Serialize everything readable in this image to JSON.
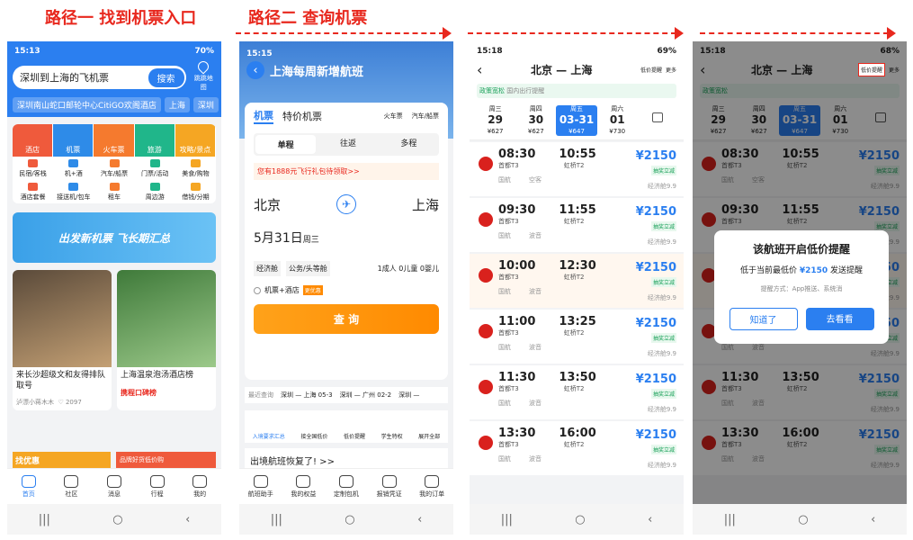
{
  "titles": {
    "path1": "路径一 找到机票入口",
    "path2": "路径二 查询机票"
  },
  "colors": {
    "accent": "#e8281e",
    "blue": "#2b7ff0",
    "orange": "#ff8a00"
  },
  "phone1": {
    "status_time": "15:13",
    "status_right": "70%",
    "search_text": "深圳到上海的飞机票",
    "search_btn": "搜索",
    "map_label": "跳跳地图",
    "chips": [
      "深圳南山蛇口邮轮中心CitiGO欢阁酒店",
      "上海",
      "深圳"
    ],
    "big_tiles": [
      "酒店",
      "机票",
      "火车票",
      "旅游",
      "攻略/景点"
    ],
    "big_colors": [
      "#ef5a3c",
      "#2e8be8",
      "#f57a2e",
      "#20b68a",
      "#f5a623"
    ],
    "small_row1": [
      "民宿/客栈",
      "机+酒",
      "汽车/船票",
      "门票/活动",
      "美食/购物"
    ],
    "small_row2": [
      "酒店套餐",
      "接送机/包车",
      "租车",
      "周边游",
      "借钱/分期"
    ],
    "banner": "出发新机票 飞长期汇总",
    "card1_title": "来长沙超级文和友得排队取号",
    "card1_user": "泸漂小蒋木木",
    "card1_views": "2097",
    "card2_title": "上海温泉泡汤酒店榜",
    "card2_tag": "携程口碑榜",
    "bottom_left": "找优惠",
    "bottom_right": "品牌好货低价购",
    "tabs": [
      "首页",
      "社区",
      "消息",
      "行程",
      "我的"
    ]
  },
  "phone2": {
    "status_time": "15:15",
    "hero_title": "上海每周新增航班",
    "tab_flight": "机票",
    "tab_special": "特价机票",
    "tab_train": "火车票",
    "tab_bus": "汽车/船票",
    "seg": [
      "单程",
      "往返",
      "多程"
    ],
    "promo": "您有1888元飞行礼包待领取>>",
    "from": "北京",
    "to": "上海",
    "date": "5月31日",
    "weekday": "周三",
    "cabin": "经济舱",
    "cabin2": "公务/头等舱",
    "pax": "1成人 0儿童 0婴儿",
    "hotel": "机票+酒店",
    "hotel_tag": "更优惠",
    "search_btn": "查 询",
    "recent_label": "最近查询",
    "recent": [
      "深圳 — 上海 05-3",
      "深圳 — 广州 02-2",
      "深圳 —"
    ],
    "quick": [
      "入境要求汇总",
      "接全国低价",
      "低价提醒",
      "学生特权",
      "展开全部"
    ],
    "notice": "出境航班恢复了! >>",
    "tabs": [
      "航班助手",
      "我的权益",
      "定制包机",
      "报销凭证",
      "我的订单"
    ]
  },
  "phone3": {
    "status_time": "15:18",
    "status_right": "69%",
    "route": "北京 — 上海",
    "alert_label": "低价提醒",
    "more_label": "更多",
    "notice": "政策宽松",
    "notice2": "国内出行提醒",
    "dates": [
      {
        "w": "周三",
        "d": "29",
        "p": "¥627"
      },
      {
        "w": "周四",
        "d": "30",
        "p": "¥627"
      },
      {
        "w": "周五",
        "d": "03-31",
        "p": "¥647"
      },
      {
        "w": "周六",
        "d": "01",
        "p": "¥730"
      }
    ],
    "flights": [
      {
        "dep": "08:30",
        "arr": "10:55",
        "da": "首都T3",
        "aa": "虹桥T2",
        "air": "国航",
        "plane": "空客",
        "price": "¥2150"
      },
      {
        "dep": "09:30",
        "arr": "11:55",
        "da": "首都T3",
        "aa": "虹桥T2",
        "air": "国航",
        "plane": "波音",
        "price": "¥2150"
      },
      {
        "dep": "10:00",
        "arr": "12:30",
        "da": "首都T3",
        "aa": "虹桥T2",
        "air": "国航",
        "plane": "波音",
        "price": "¥2150"
      },
      {
        "dep": "11:00",
        "arr": "13:25",
        "da": "首都T3",
        "aa": "虹桥T2",
        "air": "国航",
        "plane": "波音",
        "price": "¥2150"
      },
      {
        "dep": "11:30",
        "arr": "13:50",
        "da": "首都T3",
        "aa": "虹桥T2",
        "air": "国航",
        "plane": "波音",
        "price": "¥2150"
      },
      {
        "dep": "13:30",
        "arr": "16:00",
        "da": "首都T3",
        "aa": "虹桥T2",
        "air": "国航",
        "plane": "波音",
        "price": "¥2150"
      }
    ],
    "tag": "抽奖立减",
    "cabin": "经济舱9.9"
  },
  "phone4": {
    "status_time": "15:18",
    "status_right": "68%",
    "dlg_title": "该航班开启低价提醒",
    "dlg_sub_pre": "低于当前最低价",
    "dlg_sub_price": "¥2150",
    "dlg_sub_post": "发送提醒",
    "dlg_method": "提醒方式：App推送、系统消",
    "btn_ok": "知道了",
    "btn_go": "去看看"
  }
}
